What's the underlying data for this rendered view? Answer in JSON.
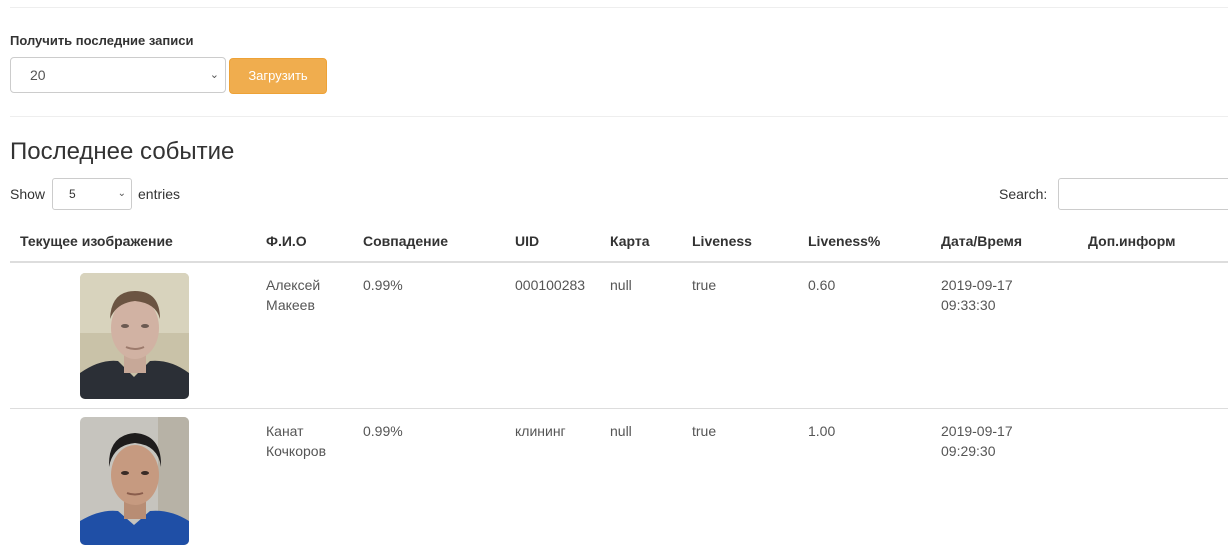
{
  "fetch": {
    "label": "Получить последние записи",
    "selected": "20",
    "load_button": "Загрузить"
  },
  "section": {
    "title": "Последнее событие"
  },
  "table_controls": {
    "show": "Show",
    "entries_value": "5",
    "entries": "entries",
    "search": "Search:"
  },
  "columns": [
    "Текущее изображение",
    "Ф.И.О",
    "Совпадение",
    "UID",
    "Карта",
    "Liveness",
    "Liveness%",
    "Дата/Время",
    "Доп.информ"
  ],
  "rows": [
    {
      "name_first": "Алексей",
      "name_last": "Макеев",
      "match": "0.99%",
      "uid": "000100283",
      "card": "null",
      "liveness": "true",
      "liveness_pct": "0.60",
      "date": "2019-09-17",
      "time": "09:33:30",
      "extra": ""
    },
    {
      "name_first": "Канат",
      "name_last": "Кочкоров",
      "match": "0.99%",
      "uid": "клининг",
      "card": "null",
      "liveness": "true",
      "liveness_pct": "1.00",
      "date": "2019-09-17",
      "time": "09:29:30",
      "extra": ""
    }
  ]
}
